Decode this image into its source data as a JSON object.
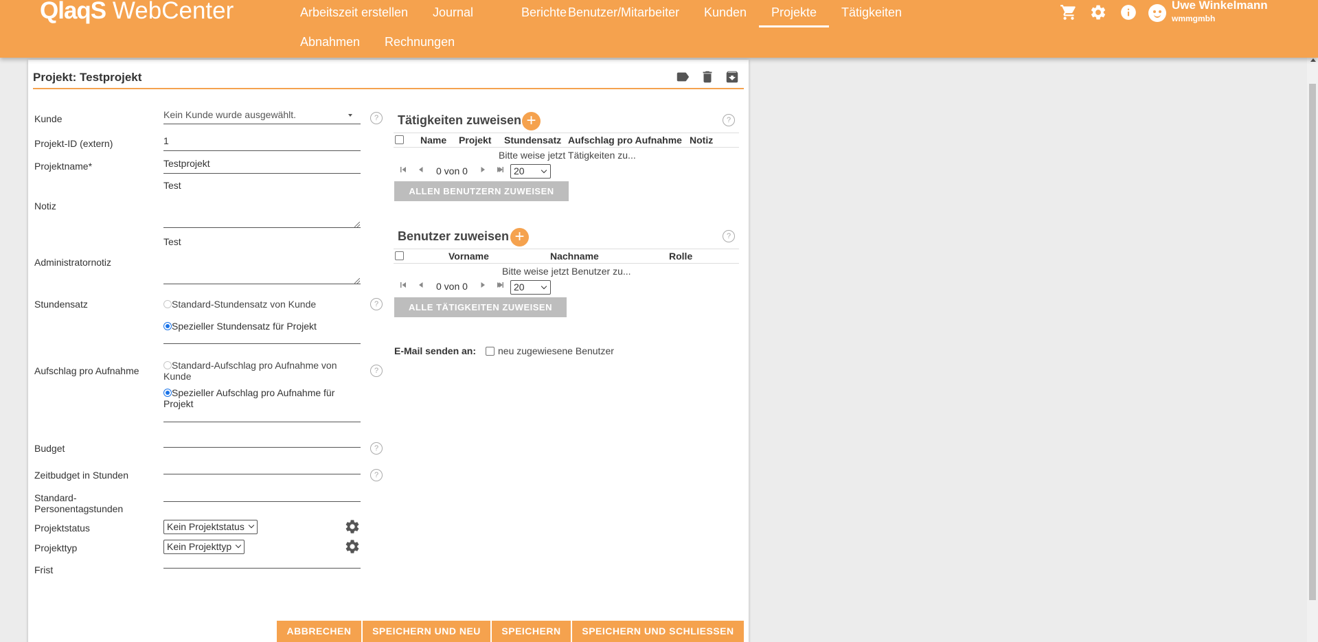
{
  "app": {
    "brand_bold": "QlaqS",
    "brand_rest": " WebCenter"
  },
  "nav": {
    "items": [
      {
        "label": "Arbeitszeit erstellen"
      },
      {
        "label": "Journal"
      },
      {
        "label": "Berichte"
      },
      {
        "label": "Benutzer/Mitarbeiter"
      },
      {
        "label": "Kunden"
      },
      {
        "label": "Projekte",
        "active": true
      },
      {
        "label": "Tätigkeiten"
      },
      {
        "label": "Abnahmen"
      },
      {
        "label": "Rechnungen"
      }
    ]
  },
  "header_icons": [
    "cart-icon",
    "settings-icon",
    "info-icon"
  ],
  "user": {
    "name": "Uwe Winkelmann",
    "org": "wmmgmbh"
  },
  "panel": {
    "title": "Projekt: Testprojekt",
    "actions": [
      "tag-icon",
      "trash-icon",
      "archive-icon"
    ]
  },
  "form": {
    "kunde": {
      "label": "Kunde",
      "value": "Kein Kunde wurde ausgewählt."
    },
    "projekt_id": {
      "label": "Projekt-ID (extern)",
      "value": "1"
    },
    "projektname": {
      "label": "Projektname*",
      "value": "Testprojekt"
    },
    "notiz": {
      "label": "Notiz",
      "value": "Test"
    },
    "adminnotiz": {
      "label": "Administratornotiz",
      "value": "Test"
    },
    "stundensatz": {
      "label": "Stundensatz",
      "option_standard": "Standard-Stundensatz von Kunde",
      "option_special": "Spezieller Stundensatz für Projekt",
      "selected": "special",
      "value": ""
    },
    "aufschlag": {
      "label": "Aufschlag pro Aufnahme",
      "option_standard_1": "Standard-Aufschlag pro Aufnahme von",
      "option_standard_2": "Kunde",
      "option_special_1": "Spezieller Aufschlag pro Aufnahme für",
      "option_special_2": "Projekt",
      "selected": "special",
      "value": ""
    },
    "budget": {
      "label": "Budget",
      "value": ""
    },
    "zeitbudget": {
      "label": "Zeitbudget in Stunden",
      "value": ""
    },
    "personentage": {
      "label_1": "Standard-",
      "label_2": "Personentagstunden",
      "value": ""
    },
    "projektstatus": {
      "label": "Projektstatus",
      "value": "Kein Projektstatus"
    },
    "projekttyp": {
      "label": "Projekttyp",
      "value": "Kein Projekttyp"
    },
    "frist": {
      "label": "Frist",
      "value": ""
    },
    "help_glyph": "?"
  },
  "taetigkeiten": {
    "title": "Tätigkeiten zuweisen",
    "add_glyph": "+",
    "columns": [
      "Name",
      "Projekt",
      "Stundensatz",
      "Aufschlag pro Aufnahme",
      "Notiz"
    ],
    "empty": "Bitte weise jetzt Tätigkeiten zu...",
    "pager": "0 von 0",
    "page_size": "20",
    "assign_button": "ALLEN BENUTZERN ZUWEISEN"
  },
  "benutzer": {
    "title": "Benutzer zuweisen",
    "add_glyph": "+",
    "columns": [
      "Vorname",
      "Nachname",
      "Rolle"
    ],
    "empty": "Bitte weise jetzt Benutzer zu...",
    "pager": "0 von 0",
    "page_size": "20",
    "assign_button": "ALLE TÄTIGKEITEN ZUWEISEN"
  },
  "email": {
    "label": "E-Mail senden an:",
    "option": "neu zugewiesene Benutzer",
    "checked": false
  },
  "footer": {
    "cancel": "ABBRECHEN",
    "save_new": "SPEICHERN UND NEU",
    "save": "SPEICHERN",
    "save_close": "SPEICHERN UND SCHLIESSEN"
  }
}
